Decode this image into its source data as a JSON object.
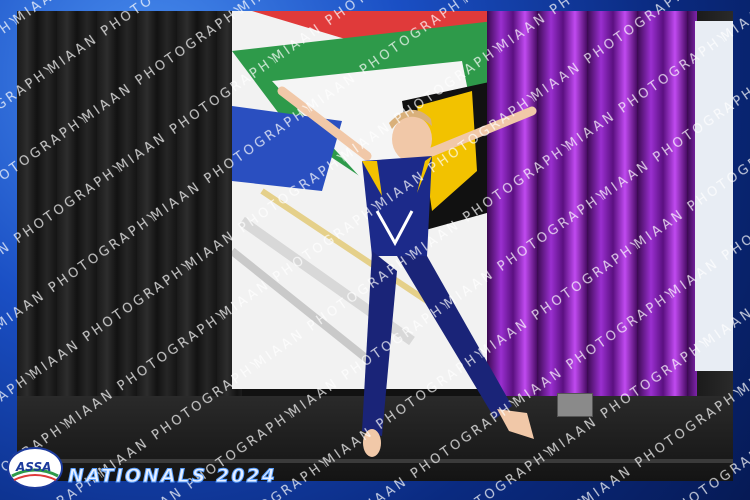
{
  "event": {
    "title": "NATIONALS 2024",
    "organization": "ASSA"
  },
  "watermark": {
    "text": "MIAAN PHOTOGRAPHY"
  },
  "scene": {
    "description_colors": {
      "frame_blue": "#1a4fc4",
      "curtain_purple": "#9a2fd0",
      "flag_red": "#e03a3a",
      "flag_green": "#2e9a4a",
      "flag_blue": "#2a4fc0",
      "flag_yellow": "#f2c200"
    }
  }
}
